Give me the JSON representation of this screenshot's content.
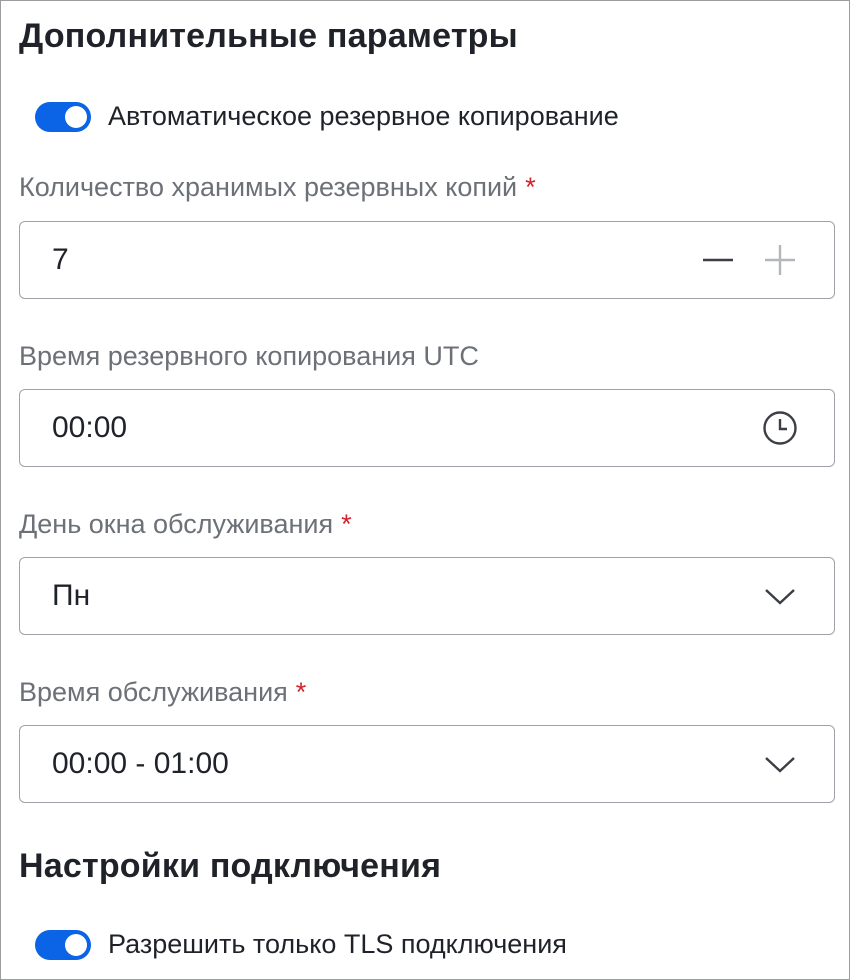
{
  "sections": {
    "additional": {
      "title": "Дополнительные параметры",
      "auto_backup_toggle": {
        "label": "Автоматическое резервное копирование",
        "checked": true
      },
      "backup_count": {
        "label": "Количество хранимых резервных копий",
        "required_mark": "*",
        "value": "7",
        "decrement_icon": "minus-icon",
        "increment_icon": "plus-icon"
      },
      "backup_time": {
        "label": "Время резервного копирования UTC",
        "value": "00:00",
        "icon": "clock-icon"
      },
      "maintenance_day": {
        "label": "День окна обслуживания",
        "required_mark": "*",
        "value": "Пн",
        "icon": "chevron-down-icon"
      },
      "maintenance_time": {
        "label": "Время обслуживания",
        "required_mark": "*",
        "value": "00:00 - 01:00",
        "icon": "chevron-down-icon"
      }
    },
    "connection": {
      "title": "Настройки подключения",
      "tls_toggle": {
        "label": "Разрешить только TLS подключения",
        "checked": true
      }
    }
  },
  "colors": {
    "accent": "#0b63e5",
    "required": "#d2232a",
    "label": "#6c7077",
    "border": "#9fa3a8",
    "text": "#1f2329"
  }
}
